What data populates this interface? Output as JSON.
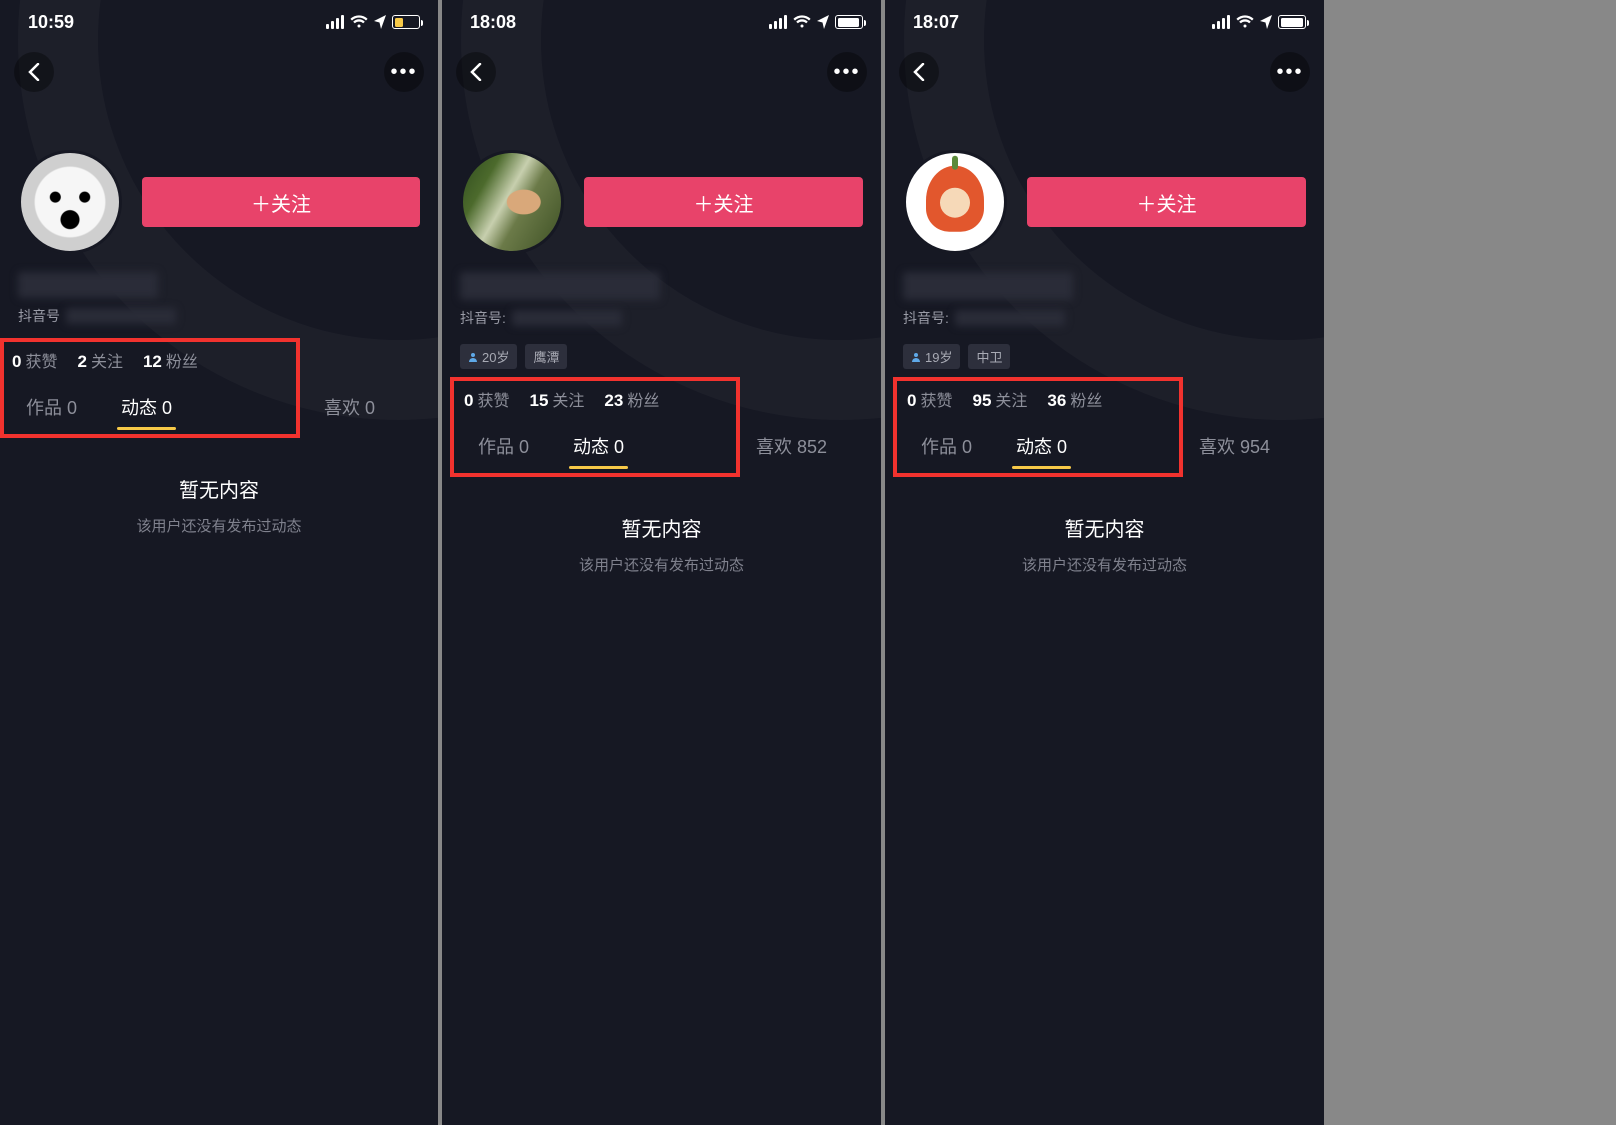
{
  "screens": [
    {
      "status": {
        "time": "10:59",
        "battery_level": 0.35,
        "battery_low": true,
        "show_location": true
      },
      "follow_label": "＋关注",
      "handle_label": "抖音号",
      "age_chip": null,
      "location_chip": null,
      "stats": {
        "likes": {
          "num": "0",
          "lbl": "获赞"
        },
        "following": {
          "num": "2",
          "lbl": "关注"
        },
        "fans": {
          "num": "12",
          "lbl": "粉丝"
        }
      },
      "tabs": {
        "works": {
          "label": "作品 0"
        },
        "feed": {
          "label": "动态 0",
          "active": true
        },
        "liked": {
          "label": "喜欢 0"
        }
      },
      "empty": {
        "title": "暂无内容",
        "sub": "该用户还没有发布过动态"
      }
    },
    {
      "status": {
        "time": "18:08",
        "battery_level": 0.92,
        "battery_low": false,
        "show_location": true
      },
      "follow_label": "＋关注",
      "handle_label": "抖音号:",
      "age_chip": "20岁",
      "location_chip": "鹰潭",
      "stats": {
        "likes": {
          "num": "0",
          "lbl": "获赞"
        },
        "following": {
          "num": "15",
          "lbl": "关注"
        },
        "fans": {
          "num": "23",
          "lbl": "粉丝"
        }
      },
      "tabs": {
        "works": {
          "label": "作品 0"
        },
        "feed": {
          "label": "动态 0",
          "active": true
        },
        "liked": {
          "label": "喜欢 852"
        }
      },
      "empty": {
        "title": "暂无内容",
        "sub": "该用户还没有发布过动态"
      }
    },
    {
      "status": {
        "time": "18:07",
        "battery_level": 0.96,
        "battery_low": false,
        "show_location": true
      },
      "follow_label": "＋关注",
      "handle_label": "抖音号:",
      "age_chip": "19岁",
      "location_chip": "中卫",
      "stats": {
        "likes": {
          "num": "0",
          "lbl": "获赞"
        },
        "following": {
          "num": "95",
          "lbl": "关注"
        },
        "fans": {
          "num": "36",
          "lbl": "粉丝"
        }
      },
      "tabs": {
        "works": {
          "label": "作品 0"
        },
        "feed": {
          "label": "动态 0",
          "active": true
        },
        "liked": {
          "label": "喜欢 954"
        }
      },
      "empty": {
        "title": "暂无内容",
        "sub": "该用户还没有发布过动态"
      }
    }
  ]
}
